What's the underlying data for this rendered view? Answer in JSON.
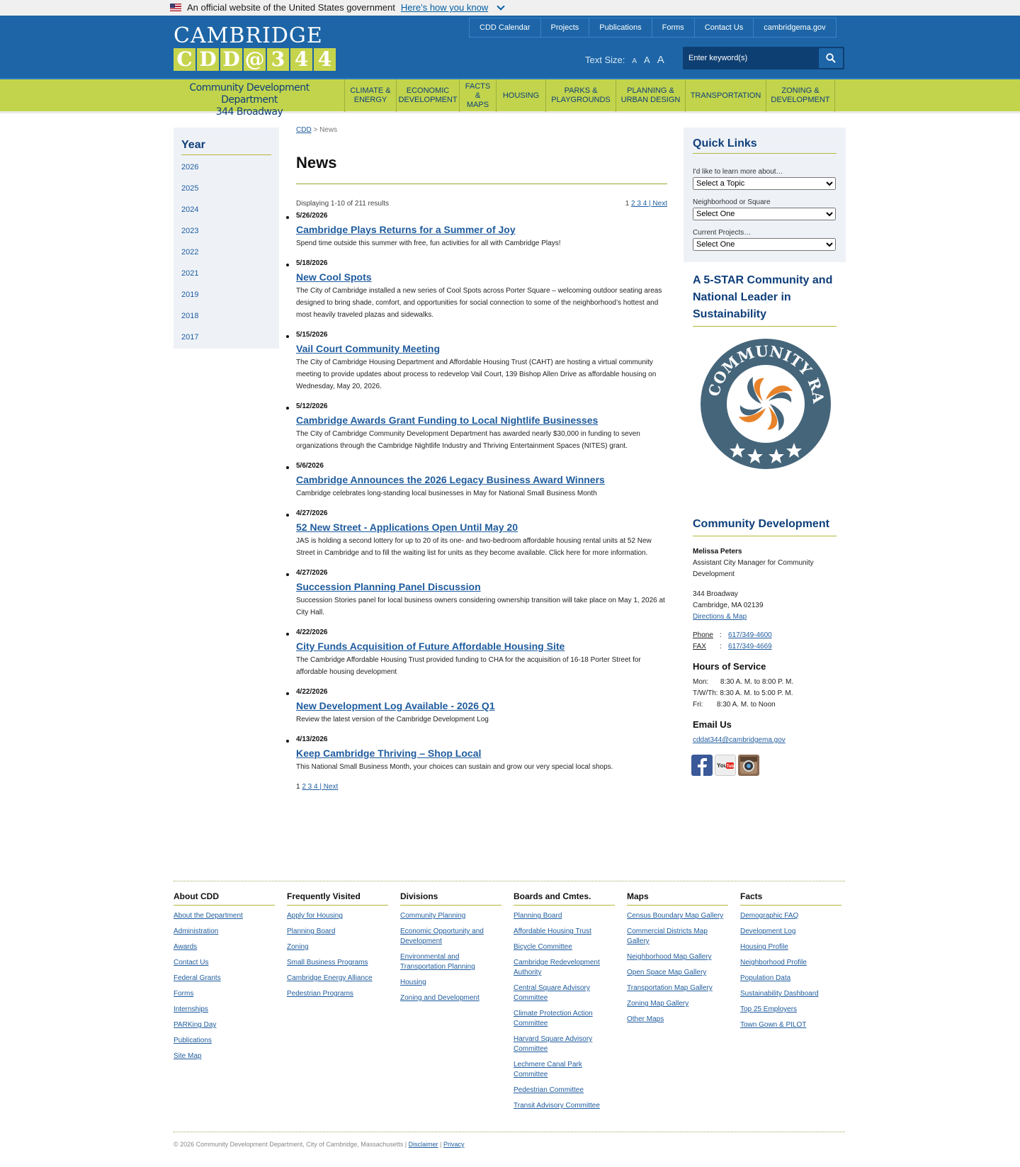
{
  "gov_banner": {
    "text": "An official website of the United States government",
    "link": "Here’s how you know"
  },
  "header": {
    "logo_line1": "CAMBRIDGE",
    "logo_line2": [
      "C",
      "D",
      "D",
      "@",
      "3",
      "4",
      "4"
    ],
    "top_nav": [
      "CDD Calendar",
      "Projects",
      "Publications",
      "Forms",
      "Contact Us",
      "cambridgema.gov"
    ],
    "text_size_label": "Text Size:",
    "text_size_options": [
      "A",
      "A",
      "A"
    ],
    "search_placeholder": "Enter keyword(s)"
  },
  "nav": {
    "brand_line1": "Community Development Department",
    "brand_line2": "344 Broadway",
    "items": [
      "CLIMATE & ENERGY",
      "ECONOMIC DEVELOPMENT",
      "FACTS & MAPS",
      "HOUSING",
      "PARKS & PLAYGROUNDS",
      "PLANNING & URBAN DESIGN",
      "TRANSPORTATION",
      "ZONING & DEVELOPMENT"
    ]
  },
  "left_sidebar": {
    "title": "Year",
    "years": [
      "2026",
      "2025",
      "2024",
      "2023",
      "2022",
      "2021",
      "2019",
      "2018",
      "2017"
    ]
  },
  "breadcrumb": {
    "home": "CDD",
    "sep": ">",
    "current": "News"
  },
  "page_title": "News",
  "results_text": "Displaying 1-10 of 211 results",
  "pagination": {
    "current": "1",
    "pages": "2 3 4 | Next"
  },
  "news": [
    {
      "date": "5/26/2026",
      "title": "Cambridge Plays Returns for a Summer of Joy",
      "desc": "Spend time outside this summer with free, fun activities for all with Cambridge Plays!"
    },
    {
      "date": "5/18/2026",
      "title": "New Cool Spots",
      "desc": "The City of Cambridge installed a new series of Cool Spots across Porter Square – welcoming outdoor seating areas designed to bring shade, comfort, and opportunities for social connection to some of the neighborhood’s hottest and most heavily traveled plazas and sidewalks."
    },
    {
      "date": "5/15/2026",
      "title": "Vail Court Community Meeting",
      "desc": "The City of Cambridge Housing Department and Affordable Housing Trust (CAHT) are hosting a virtual community meeting to provide updates about process to redevelop Vail Court, 139 Bishop Allen Drive as affordable housing on Wednesday, May 20, 2026."
    },
    {
      "date": "5/12/2026",
      "title": "Cambridge Awards Grant Funding to Local Nightlife Businesses",
      "desc": "The City of Cambridge Community Development Department has awarded nearly $30,000 in funding to seven organizations through the Cambridge Nightlife Industry and Thriving Entertainment Spaces (NITES) grant."
    },
    {
      "date": "5/6/2026",
      "title": "Cambridge Announces the 2026 Legacy Business Award Winners",
      "desc": "Cambridge celebrates long-standing local businesses in May for National Small Business Month"
    },
    {
      "date": "4/27/2026",
      "title": "52 New Street - Applications Open Until May 20",
      "desc": "JAS is holding a second lottery for up to 20 of its one- and two-bedroom affordable housing rental units at 52 New Street in Cambridge and to fill the waiting list for units as they become available. Click here for more information."
    },
    {
      "date": "4/27/2026",
      "title": "Succession Planning Panel Discussion",
      "desc": "Succession Stories panel for local business owners considering ownership transition will take place on May 1, 2026 at City Hall."
    },
    {
      "date": "4/22/2026",
      "title": "City Funds Acquisition of Future Affordable Housing Site",
      "desc": "The Cambridge Affordable Housing Trust provided funding to CHA for the acquisition of 16-18 Porter Street for affordable housing development"
    },
    {
      "date": "4/22/2026",
      "title": "New Development Log Available - 2026 Q1",
      "desc": "Review the latest version of the Cambridge Development Log"
    },
    {
      "date": "4/13/2026",
      "title": "Keep Cambridge Thriving – Shop Local",
      "desc": "This National Small Business Month, your choices can sustain and grow our very special local shops."
    }
  ],
  "quick_links": {
    "title": "Quick Links",
    "topic_label": "I'd like to learn more about…",
    "topic_value": "Select a Topic",
    "neighborhood_label": "Neighborhood or Square",
    "neighborhood_value": "Select One",
    "projects_label": "Current Projects…",
    "projects_value": "Select One"
  },
  "star_section": {
    "title": "A 5-STAR Community and National Leader in Sustainability",
    "seal_text": "STAR COMMUNITY RATING"
  },
  "contact": {
    "title": "Community Development",
    "name": "Melissa Peters",
    "role": "Assistant City Manager for Community Development",
    "address1": "344 Broadway",
    "address2": "Cambridge, MA 02139",
    "directions": "Directions & Map",
    "phone_label": "Phone",
    "phone": "617/349-4600",
    "fax_label": "FAX",
    "fax": "617/349-4669",
    "hours_title": "Hours of Service",
    "hours": [
      "Mon:      8:30 A. M. to 8:00 P. M.",
      "T/W/Th: 8:30 A. M. to 5:00 P. M.",
      "Fri:       8:30 A. M. to Noon"
    ],
    "email_title": "Email Us",
    "email": "cddat344@cambridgema.gov",
    "social_icons": [
      "facebook-icon",
      "youtube-icon",
      "instagram-icon"
    ],
    "colors": {
      "facebook": "#3b5998",
      "youtube": "#e62117",
      "instagram": "#8a6a52"
    }
  },
  "footer": {
    "columns": [
      {
        "title": "About CDD",
        "links": [
          "About the Department",
          "Administration",
          "Awards",
          "Contact Us",
          "Federal Grants",
          "Forms",
          "Internships",
          "PARKing Day",
          "Publications",
          "Site Map"
        ]
      },
      {
        "title": "Frequently Visited",
        "links": [
          "Apply for Housing",
          "Planning Board",
          "Zoning",
          "Small Business Programs",
          "Cambridge Energy Alliance",
          "Pedestrian Programs"
        ]
      },
      {
        "title": "Divisions",
        "links": [
          "Community Planning",
          "Economic Opportunity and Development",
          "Environmental and Transportation Planning",
          "Housing",
          "Zoning and Development"
        ]
      },
      {
        "title": "Boards and Cmtes.",
        "links": [
          "Planning Board",
          "Affordable Housing Trust",
          "Bicycle Committee",
          "Cambridge Redevelopment Authority",
          "Central Square Advisory Committee",
          "Climate Protection Action Committee",
          "Harvard Square Advisory Committee",
          "Lechmere Canal Park Committee",
          "Pedestrian Committee",
          "Transit Advisory Committee"
        ]
      },
      {
        "title": "Maps",
        "links": [
          "Census Boundary Map Gallery",
          "Commercial Districts Map Gallery",
          "Neighborhood Map Gallery",
          "Open Space Map Gallery",
          "Transportation Map Gallery",
          "Zoning Map Gallery",
          "Other Maps"
        ]
      },
      {
        "title": "Facts",
        "links": [
          "Demographic FAQ",
          "Development Log",
          "Housing Profile",
          "Neighborhood Profile",
          "Population Data",
          "Sustainability Dashboard",
          "Top 25 Employers",
          "Town Gown & PILOT"
        ]
      }
    ],
    "copyright": "© 2026 Community Development Department, City of Cambridge, Massachusetts |",
    "disclaimer": "Disclaimer",
    "privacy": "Privacy"
  },
  "colors": {
    "header_blue": "#1d65a6",
    "nav_green": "#c1d44c",
    "link_blue": "#1f5c9e",
    "title_navy": "#0f3f7a"
  }
}
